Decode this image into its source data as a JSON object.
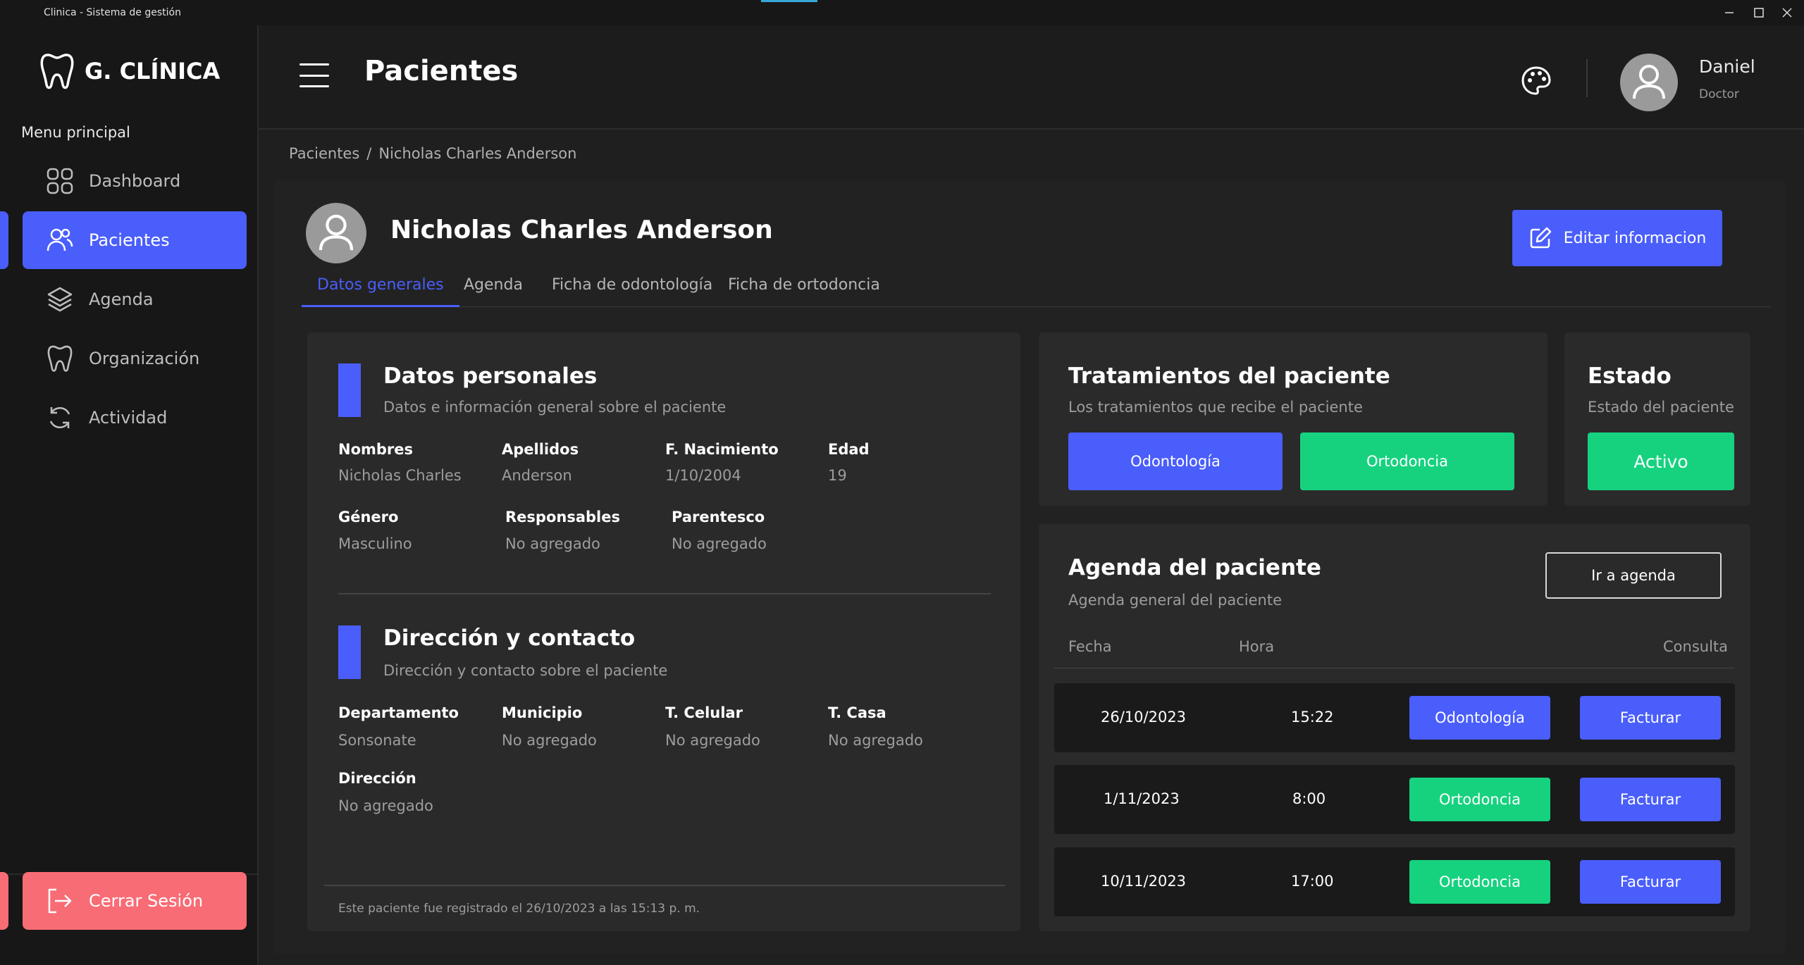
{
  "window": {
    "title": "Clinica - Sistema de gestión"
  },
  "sidebar": {
    "logo_text": "G. CLÍNICA",
    "menu_title": "Menu principal",
    "items": [
      {
        "label": "Dashboard",
        "icon": "grid-icon"
      },
      {
        "label": "Pacientes",
        "icon": "users-icon",
        "active": true
      },
      {
        "label": "Agenda",
        "icon": "layers-icon"
      },
      {
        "label": "Organización",
        "icon": "tooth-icon"
      },
      {
        "label": "Actividad",
        "icon": "refresh-icon"
      }
    ],
    "logout_label": "Cerrar Sesión"
  },
  "header": {
    "title": "Pacientes",
    "user": {
      "name": "Daniel",
      "role": "Doctor"
    }
  },
  "breadcrumb": {
    "parent": "Pacientes",
    "separator": "/",
    "current": "Nicholas Charles Anderson"
  },
  "patient": {
    "name": "Nicholas Charles Anderson",
    "edit_label": "Editar informacion"
  },
  "tabs": [
    "Datos generales",
    "Agenda",
    "Ficha de odontología",
    "Ficha de ortodoncia"
  ],
  "personal": {
    "title": "Datos personales",
    "subtitle": "Datos e información general sobre el paciente",
    "fields": [
      {
        "label": "Nombres",
        "value": "Nicholas Charles"
      },
      {
        "label": "Apellidos",
        "value": "Anderson"
      },
      {
        "label": "F. Nacimiento",
        "value": "1/10/2004"
      },
      {
        "label": "Edad",
        "value": "19"
      },
      {
        "label": "Género",
        "value": "Masculino"
      },
      {
        "label": "Responsables",
        "value": "No agregado"
      },
      {
        "label": "Parentesco",
        "value": "No agregado"
      }
    ]
  },
  "contact": {
    "title": "Dirección y contacto",
    "subtitle": "Dirección y contacto sobre el paciente",
    "fields": [
      {
        "label": "Departamento",
        "value": "Sonsonate"
      },
      {
        "label": "Municipio",
        "value": "No agregado"
      },
      {
        "label": "T. Celular",
        "value": "No agregado"
      },
      {
        "label": "T. Casa",
        "value": "No agregado"
      },
      {
        "label": "Dirección",
        "value": "No agregado"
      }
    ]
  },
  "registered_note": "Este paciente fue registrado el 26/10/2023 a las 15:13 p. m.",
  "treatments": {
    "title": "Tratamientos del paciente",
    "subtitle": "Los tratamientos que recibe el paciente",
    "items": [
      "Odontología",
      "Ortodoncia"
    ]
  },
  "status": {
    "title": "Estado",
    "subtitle": "Estado del paciente",
    "value": "Activo"
  },
  "agenda": {
    "title": "Agenda del paciente",
    "subtitle": "Agenda general del paciente",
    "goto_label": "Ir a agenda",
    "columns": [
      "Fecha",
      "Hora",
      "Consulta"
    ],
    "rows": [
      {
        "date": "26/10/2023",
        "time": "15:22",
        "type": "Odontología",
        "action": "Facturar"
      },
      {
        "date": "1/11/2023",
        "time": "8:00",
        "type": "Ortodoncia",
        "action": "Facturar"
      },
      {
        "date": "10/11/2023",
        "time": "17:00",
        "type": "Ortodoncia",
        "action": "Facturar"
      }
    ]
  },
  "colors": {
    "accent": "#4a5efb",
    "green": "#16d27f",
    "danger": "#f86c75",
    "background": "#1f1f1f"
  }
}
